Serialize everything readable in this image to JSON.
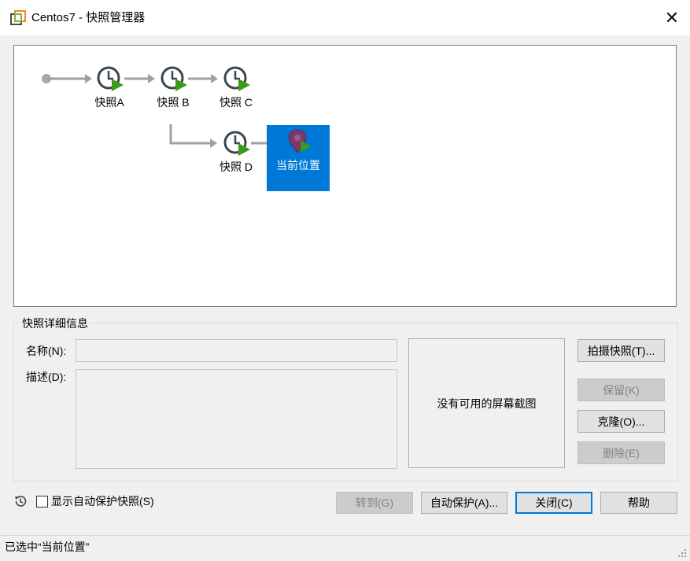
{
  "window": {
    "title": "Centos7 - 快照管理器",
    "close_glyph": "✕"
  },
  "snapshot_tree": {
    "nodes": [
      {
        "label": "快照A",
        "icon": "snapshot-clock-icon",
        "selected": false
      },
      {
        "label": "快照 B",
        "icon": "snapshot-clock-icon",
        "selected": false
      },
      {
        "label": "快照 C",
        "icon": "snapshot-clock-icon",
        "selected": false
      },
      {
        "label": "快照 D",
        "icon": "snapshot-clock-icon",
        "selected": false
      },
      {
        "label": "当前位置",
        "icon": "current-location-pin-icon",
        "selected": true
      }
    ]
  },
  "details": {
    "group_label": "快照详细信息",
    "name_label": "名称(N):",
    "name_value": "",
    "description_label": "描述(D):",
    "description_value": "",
    "screenshot_placeholder": "没有可用的屏幕截图"
  },
  "side_buttons": {
    "take_snapshot": "拍摄快照(T)...",
    "keep": "保留(K)",
    "clone": "克隆(O)...",
    "delete": "删除(E)"
  },
  "bottom": {
    "show_autoprotect_label": "显示自动保护快照(S)",
    "show_autoprotect_checked": false,
    "goto": "转到(G)",
    "autoprotect": "自动保护(A)...",
    "close": "关闭(C)",
    "help": "帮助"
  },
  "status": {
    "text": "已选中“当前位置”"
  },
  "colors": {
    "selection": "#0078d7",
    "clock_dark": "#3c4650",
    "play_green": "#3e9a1e",
    "connector_gray": "#a0a0a0",
    "pin_purple": "#7a3b6a"
  }
}
